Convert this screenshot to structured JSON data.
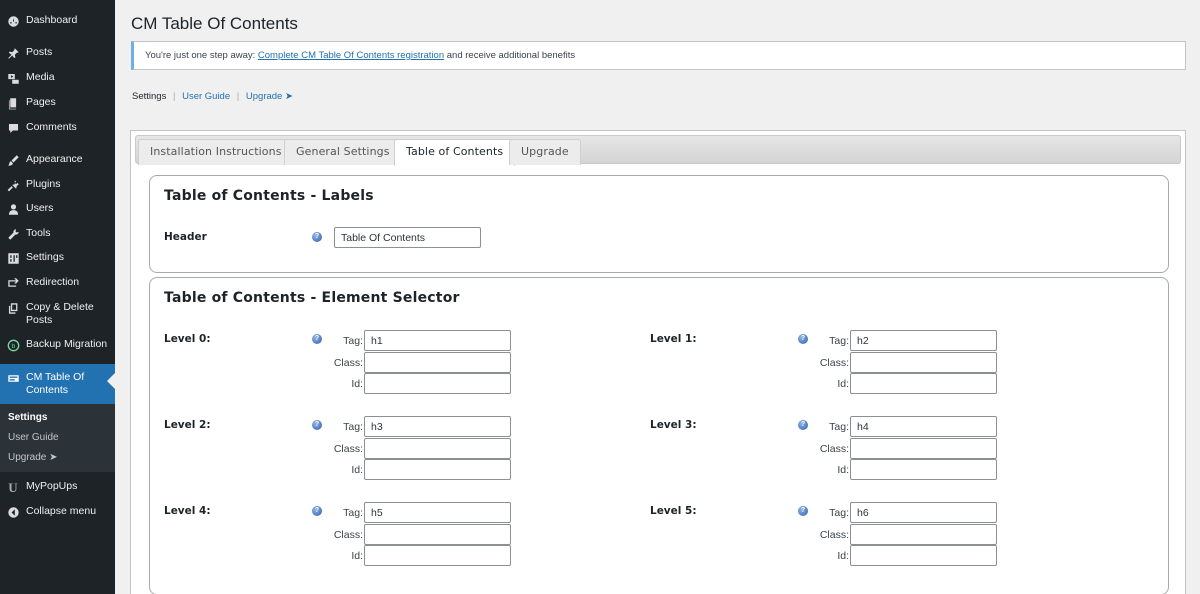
{
  "sidebar": {
    "items": [
      {
        "label": "Dashboard",
        "icon": "dashboard-icon"
      },
      {
        "label": "Posts",
        "icon": "pin-icon"
      },
      {
        "label": "Media",
        "icon": "media-icon"
      },
      {
        "label": "Pages",
        "icon": "pages-icon"
      },
      {
        "label": "Comments",
        "icon": "comment-icon"
      },
      {
        "label": "Appearance",
        "icon": "brush-icon"
      },
      {
        "label": "Plugins",
        "icon": "plug-icon"
      },
      {
        "label": "Users",
        "icon": "user-icon"
      },
      {
        "label": "Tools",
        "icon": "wrench-icon"
      },
      {
        "label": "Settings",
        "icon": "settings-icon"
      },
      {
        "label": "Redirection",
        "icon": "redirect-icon"
      },
      {
        "label": "Copy & Delete Posts",
        "icon": "copy-icon"
      },
      {
        "label": "Backup Migration",
        "icon": "backup-icon"
      },
      {
        "label": "CM Table Of Contents",
        "icon": "toc-icon"
      },
      {
        "label": "MyPopUps",
        "icon": "popup-icon"
      },
      {
        "label": "Collapse menu",
        "icon": "collapse-icon"
      }
    ],
    "submenu": [
      "Settings",
      "User Guide",
      "Upgrade ➤"
    ]
  },
  "page": {
    "title": "CM Table Of Contents",
    "notice_pre": "You're just one step away: ",
    "notice_link": "Complete CM Table Of Contents registration",
    "notice_post": " and receive additional benefits",
    "subnav": {
      "settings": "Settings",
      "sep": "|",
      "guide": "User Guide",
      "upgrade": "Upgrade ➤"
    }
  },
  "tabs": [
    "Installation Instructions",
    "General Settings",
    "Table of Contents",
    "Upgrade"
  ],
  "labels_box": {
    "title": "Table of Contents - Labels",
    "header_label": "Header",
    "header_value": "Table Of Contents"
  },
  "selector_box": {
    "title": "Table of Contents - Element Selector",
    "tag_label": "Tag:",
    "class_label": "Class:",
    "id_label": "Id:",
    "help_glyph": "?",
    "levels": [
      {
        "label": "Level 0:",
        "tag": "h1",
        "class": "",
        "id": ""
      },
      {
        "label": "Level 1:",
        "tag": "h2",
        "class": "",
        "id": ""
      },
      {
        "label": "Level 2:",
        "tag": "h3",
        "class": "",
        "id": ""
      },
      {
        "label": "Level 3:",
        "tag": "h4",
        "class": "",
        "id": ""
      },
      {
        "label": "Level 4:",
        "tag": "h5",
        "class": "",
        "id": ""
      },
      {
        "label": "Level 5:",
        "tag": "h6",
        "class": "",
        "id": ""
      }
    ]
  },
  "colors": {
    "sidebar_bg": "#1d2327",
    "active_menu": "#2271b1",
    "link": "#2271b1",
    "notice_border": "#72aee6"
  }
}
